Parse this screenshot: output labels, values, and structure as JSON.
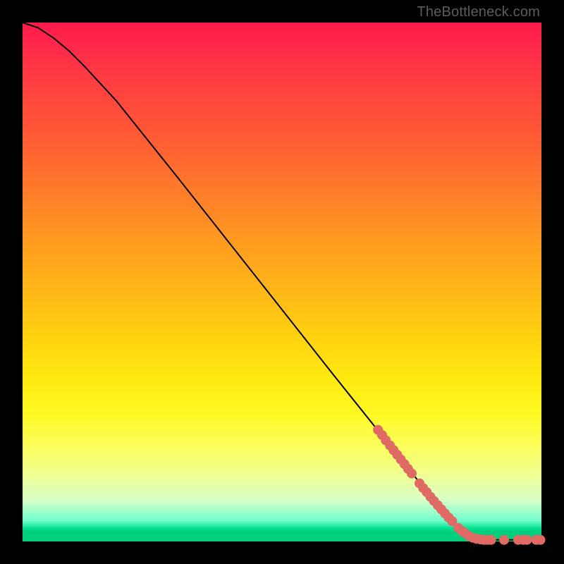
{
  "attribution": "TheBottleneck.com",
  "chart_data": {
    "type": "line",
    "title": "",
    "xlabel": "",
    "ylabel": "",
    "xlim": [
      0,
      100
    ],
    "ylim": [
      0,
      100
    ],
    "grid": false,
    "curve": [
      {
        "x": 0,
        "y": 100
      },
      {
        "x": 3,
        "y": 99
      },
      {
        "x": 6,
        "y": 97
      },
      {
        "x": 9,
        "y": 94.5
      },
      {
        "x": 12,
        "y": 91.5
      },
      {
        "x": 18,
        "y": 85
      },
      {
        "x": 30,
        "y": 70
      },
      {
        "x": 45,
        "y": 51
      },
      {
        "x": 60,
        "y": 32
      },
      {
        "x": 70,
        "y": 19.5
      },
      {
        "x": 76,
        "y": 12
      },
      {
        "x": 80,
        "y": 7
      },
      {
        "x": 83,
        "y": 3.5
      },
      {
        "x": 85,
        "y": 1.5
      },
      {
        "x": 87,
        "y": 0.6
      },
      {
        "x": 90,
        "y": 0.3
      },
      {
        "x": 100,
        "y": 0.3
      }
    ],
    "scatter_points": [
      {
        "x": 68.5,
        "y": 21.5
      },
      {
        "x": 69.3,
        "y": 20.5
      },
      {
        "x": 70.0,
        "y": 19.5
      },
      {
        "x": 70.8,
        "y": 18.5
      },
      {
        "x": 71.5,
        "y": 17.6
      },
      {
        "x": 72.2,
        "y": 16.7
      },
      {
        "x": 72.9,
        "y": 15.8
      },
      {
        "x": 73.6,
        "y": 14.9
      },
      {
        "x": 74.3,
        "y": 14.0
      },
      {
        "x": 75.0,
        "y": 13.1
      },
      {
        "x": 76.5,
        "y": 11.2
      },
      {
        "x": 77.2,
        "y": 10.3
      },
      {
        "x": 77.9,
        "y": 9.5
      },
      {
        "x": 78.6,
        "y": 8.6
      },
      {
        "x": 79.3,
        "y": 7.8
      },
      {
        "x": 80.0,
        "y": 7.0
      },
      {
        "x": 80.7,
        "y": 6.2
      },
      {
        "x": 81.4,
        "y": 5.4
      },
      {
        "x": 82.1,
        "y": 4.6
      },
      {
        "x": 82.8,
        "y": 3.9
      },
      {
        "x": 84.0,
        "y": 2.6
      },
      {
        "x": 84.7,
        "y": 2.0
      },
      {
        "x": 85.4,
        "y": 1.5
      },
      {
        "x": 86.1,
        "y": 1.0
      },
      {
        "x": 86.8,
        "y": 0.7
      },
      {
        "x": 87.5,
        "y": 0.5
      },
      {
        "x": 88.2,
        "y": 0.4
      },
      {
        "x": 88.9,
        "y": 0.3
      },
      {
        "x": 89.6,
        "y": 0.3
      },
      {
        "x": 90.3,
        "y": 0.3
      },
      {
        "x": 92.8,
        "y": 0.3
      },
      {
        "x": 95.5,
        "y": 0.3
      },
      {
        "x": 96.5,
        "y": 0.3
      },
      {
        "x": 97.2,
        "y": 0.3
      },
      {
        "x": 99.0,
        "y": 0.3
      },
      {
        "x": 99.8,
        "y": 0.3
      }
    ],
    "dot_color": "#e06a64",
    "curve_color": "#000000",
    "dot_radius_px": 7
  }
}
